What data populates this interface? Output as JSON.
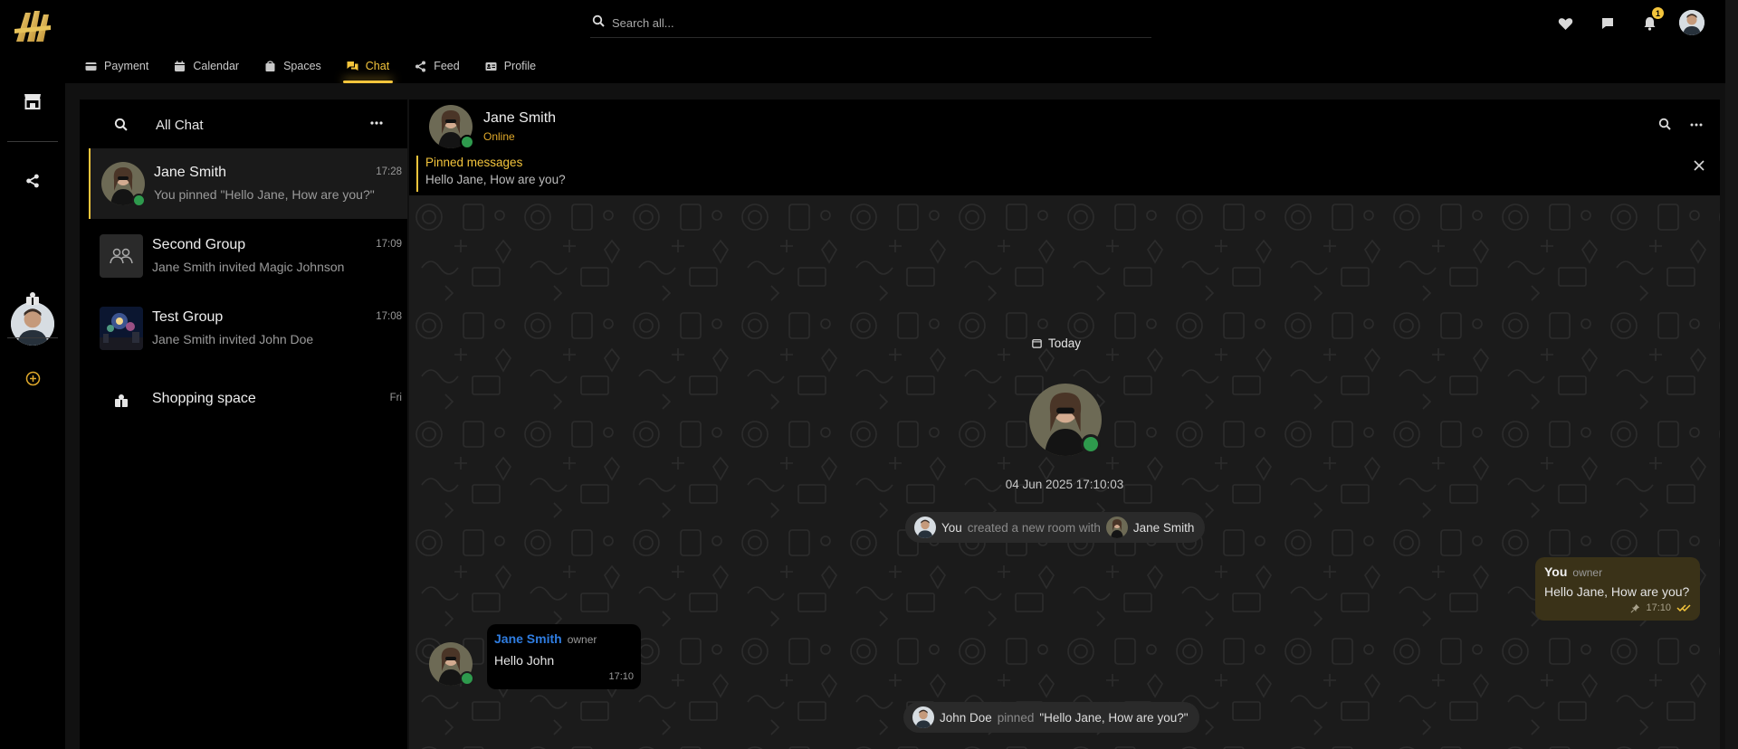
{
  "header": {
    "search_placeholder": "Search all...",
    "notifications_count": "1"
  },
  "tabs": [
    {
      "label": "Payment",
      "icon": "credit-card-icon"
    },
    {
      "label": "Calendar",
      "icon": "calendar-icon"
    },
    {
      "label": "Spaces",
      "icon": "spaces-icon"
    },
    {
      "label": "Chat",
      "icon": "chat-icon",
      "active": true
    },
    {
      "label": "Feed",
      "icon": "share-icon"
    },
    {
      "label": "Profile",
      "icon": "id-card-icon"
    }
  ],
  "chat_list": {
    "title": "All Chat",
    "items": [
      {
        "name": "Jane Smith",
        "subtitle": "You pinned \"Hello Jane, How are you?\"",
        "time": "17:28",
        "online": true
      },
      {
        "name": "Second Group",
        "subtitle": "Jane Smith invited Magic Johnson",
        "time": "17:09"
      },
      {
        "name": "Test Group",
        "subtitle": "Jane Smith invited John Doe",
        "time": "17:08"
      },
      {
        "name": "Shopping space",
        "subtitle": "",
        "time": "Fri"
      }
    ]
  },
  "conversation": {
    "name": "Jane Smith",
    "status": "Online",
    "pinned_title": "Pinned messages",
    "pinned_text": "Hello Jane, How are you?",
    "date_label": "Today",
    "created_stamp": "04 Jun 2025 17:10:03",
    "created_event": {
      "actor": "You",
      "action": "created a new room with",
      "target": "Jane Smith"
    },
    "outgoing": {
      "sender": "You",
      "role": "owner",
      "text": "Hello Jane, How are you?",
      "time": "17:10"
    },
    "incoming": {
      "sender": "Jane Smith",
      "role": "owner",
      "text": "Hello John",
      "time": "17:10"
    },
    "pin_event": {
      "actor": "John Doe",
      "action": "pinned",
      "quote": "\"Hello Jane, How are you?\""
    }
  },
  "colors": {
    "accent": "#f4c53c",
    "online": "#2e9a4d",
    "sender_blue": "#2f7de1",
    "outgoing_bubble": "#3a3218"
  }
}
